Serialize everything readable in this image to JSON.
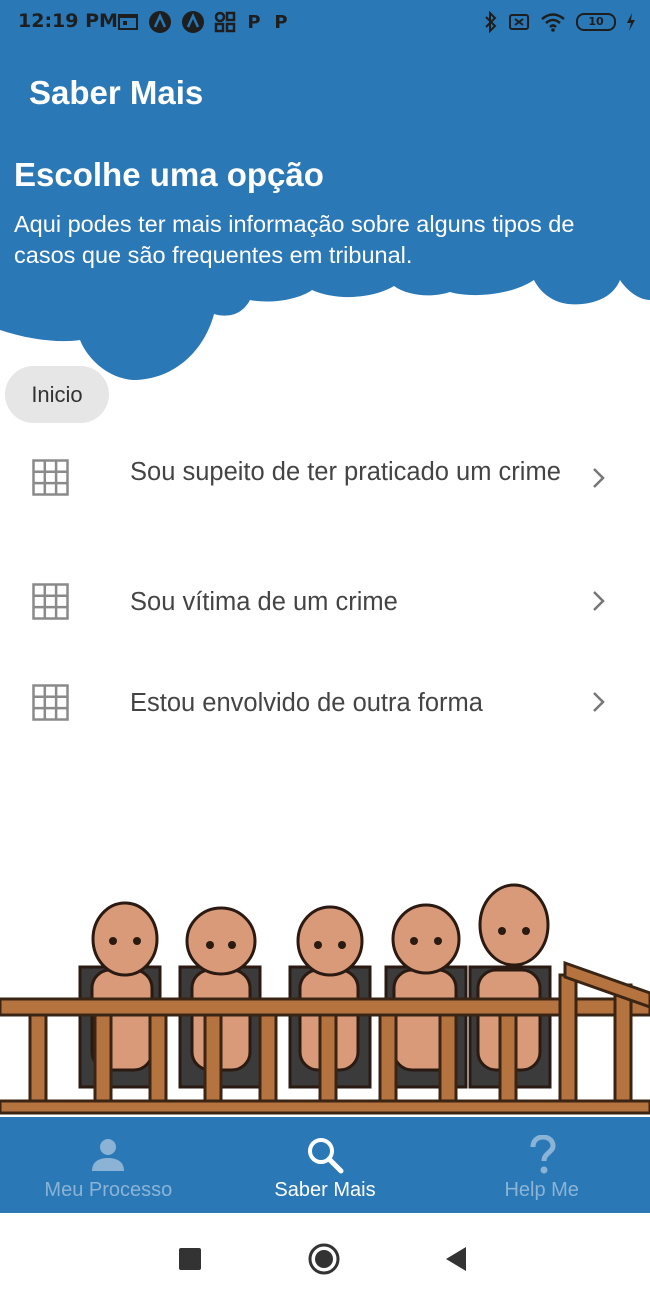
{
  "status_bar": {
    "time": "12:19 PM",
    "left_icons": [
      "window-icon",
      "navigation-a-icon",
      "navigation-a-icon",
      "apps-grid-icon",
      "p-icon",
      "p-icon"
    ],
    "p_glyph": "P",
    "battery": "10",
    "right_icons": [
      "bluetooth-icon",
      "no-sim-icon",
      "wifi-icon",
      "battery-icon",
      "charging-icon"
    ]
  },
  "header": {
    "title": "Saber Mais",
    "heading": "Escolhe uma opção",
    "description": "Aqui podes ter mais informação sobre alguns tipos de casos que são frequentes em tribunal.",
    "color": "#2b78b6"
  },
  "breadcrumb": {
    "label": "Inicio"
  },
  "options": [
    {
      "label": "Sou supeito de ter praticado um crime",
      "icon": "grid-icon"
    },
    {
      "label": "Sou vítima de um crime",
      "icon": "grid-icon"
    },
    {
      "label": "Estou envolvido de outra forma",
      "icon": "grid-icon"
    }
  ],
  "illustration": {
    "icon": "jury-illustration"
  },
  "bottom_nav": {
    "items": [
      {
        "label": "Meu Processo",
        "icon": "person-icon",
        "active": false
      },
      {
        "label": "Saber Mais",
        "icon": "search-icon",
        "active": true
      },
      {
        "label": "Help Me",
        "icon": "question-icon",
        "active": false
      }
    ],
    "active_color": "#ffffff",
    "inactive_color": "#8ab3d6"
  },
  "system_nav": [
    "recents-button",
    "home-button",
    "back-button"
  ]
}
